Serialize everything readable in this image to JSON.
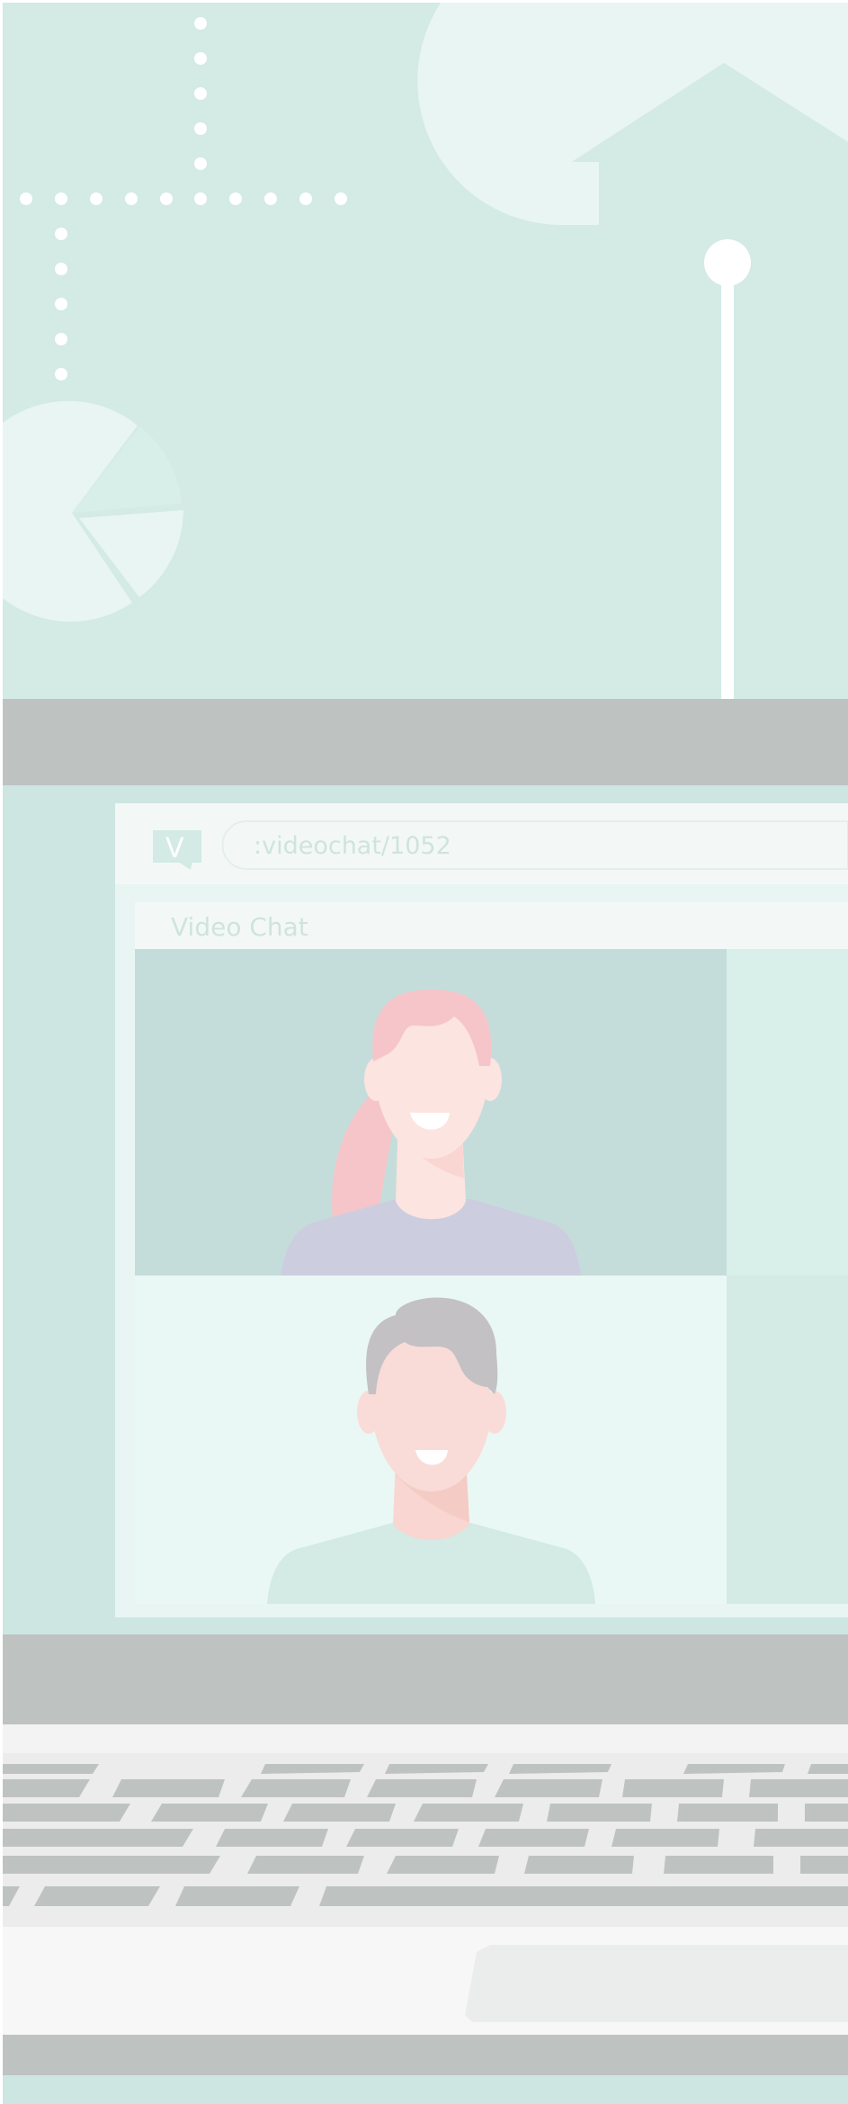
{
  "app": {
    "logo_letter": "V",
    "url": ":videochat/1052",
    "window_title": "Video Chat"
  },
  "participants": [
    {
      "name_icon": "woman-avatar-icon"
    },
    {
      "name_icon": "man-avatar-icon"
    }
  ],
  "colors": {
    "background": "#d3eae5",
    "laptop_frame": "#bec3c2",
    "browser_panel": "#f3f8f6",
    "tile_top_left": "#c5ddda",
    "tile_bottom_left": "#eaf8f5",
    "keyboard_key": "#bec3c2",
    "pink_hair": "#f5c5c9",
    "gray_hair": "#c3c1c3",
    "skin": "#f9dcd8",
    "shirt_lavender": "#cccee0",
    "shirt_mint": "#d3eae5"
  },
  "keyboard": {
    "rows": 6
  }
}
